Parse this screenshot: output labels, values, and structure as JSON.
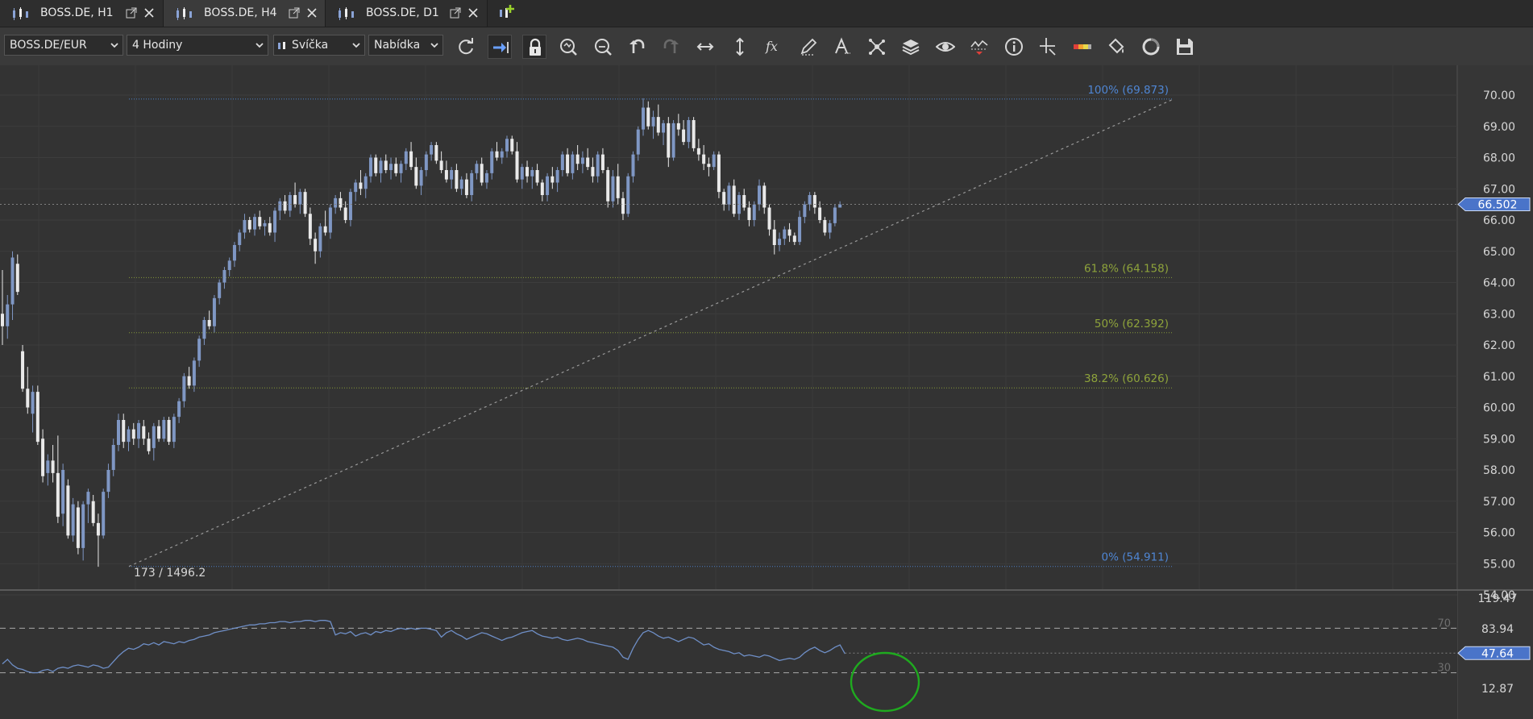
{
  "tabs": [
    {
      "label": "BOSS.DE, H1",
      "active": false
    },
    {
      "label": "BOSS.DE, H4",
      "active": true
    },
    {
      "label": "BOSS.DE, D1",
      "active": false
    }
  ],
  "toolbar": {
    "instrument": "BOSS.DE/EUR",
    "period": "4 Hodiny",
    "chart_type": "Svíčka",
    "offer_side": "Nabídka",
    "tools": [
      "refresh-icon",
      "shift-chart-icon",
      "lock-icon",
      "zoom-in-icon",
      "zoom-out-icon",
      "undo-icon",
      "redo-icon",
      "horizontal-scale-icon",
      "vertical-scale-icon",
      "indicators-fx-icon",
      "draw-pencil-icon",
      "text-tool-icon",
      "patterns-icon",
      "layers-icon",
      "eye-icon",
      "alerts-chart-icon",
      "info-icon",
      "crosshair-icon",
      "theme-color-icon",
      "paint-bucket-icon",
      "template-icon",
      "save-icon"
    ]
  },
  "colors": {
    "background": "#343434",
    "bull_candle": "#7f97c4",
    "bear_candle": "#e9e9e9",
    "fib_blue": "#4f86d4",
    "fib_green": "#8ea33b",
    "rsi_line": "#6f8fc7",
    "highlight_circle": "#1faa1f"
  },
  "chart_data": {
    "type": "candlestick",
    "symbol": "BOSS.DE/EUR",
    "period": "4 Hodiny",
    "price_axis_ticks": [
      "70.00",
      "69.00",
      "68.00",
      "67.00",
      "66.00",
      "65.00",
      "64.00",
      "63.00",
      "62.00",
      "61.00",
      "60.00",
      "59.00",
      "58.00",
      "57.00",
      "56.00",
      "55.00",
      "54.00"
    ],
    "current_price": "66.502",
    "ohlc": [
      [
        63.0,
        64.4,
        62.0,
        62.6
      ],
      [
        62.6,
        63.6,
        62.2,
        63.3
      ],
      [
        63.3,
        65.0,
        62.8,
        64.8
      ],
      [
        64.6,
        64.9,
        63.6,
        63.7
      ],
      [
        61.8,
        62.0,
        60.5,
        60.6
      ],
      [
        60.6,
        61.3,
        59.8,
        60.0
      ],
      [
        59.8,
        60.7,
        59.2,
        60.5
      ],
      [
        60.5,
        60.7,
        58.8,
        58.9
      ],
      [
        59.0,
        59.3,
        57.6,
        57.8
      ],
      [
        57.9,
        58.5,
        57.5,
        58.3
      ],
      [
        58.3,
        58.8,
        57.6,
        57.9
      ],
      [
        57.9,
        59.1,
        56.3,
        56.5
      ],
      [
        56.6,
        58.2,
        56.2,
        58.0
      ],
      [
        57.5,
        57.7,
        55.8,
        55.9
      ],
      [
        55.9,
        57.1,
        55.7,
        56.9
      ],
      [
        56.8,
        57.0,
        55.3,
        55.5
      ],
      [
        55.5,
        57.0,
        55.1,
        56.9
      ],
      [
        56.9,
        57.4,
        56.3,
        57.3
      ],
      [
        57.0,
        57.2,
        56.2,
        56.3
      ],
      [
        56.3,
        56.6,
        54.9,
        55.9
      ],
      [
        55.9,
        57.4,
        55.8,
        57.3
      ],
      [
        57.3,
        58.2,
        57.1,
        58.0
      ],
      [
        58.0,
        59.0,
        57.8,
        58.8
      ],
      [
        58.8,
        59.8,
        58.6,
        59.6
      ],
      [
        59.6,
        59.8,
        58.7,
        58.9
      ],
      [
        58.9,
        59.4,
        58.6,
        59.3
      ],
      [
        59.3,
        59.5,
        58.8,
        59.0
      ],
      [
        59.0,
        59.6,
        58.7,
        59.5
      ],
      [
        59.4,
        59.6,
        58.8,
        59.0
      ],
      [
        59.0,
        59.2,
        58.5,
        58.6
      ],
      [
        58.7,
        59.5,
        58.3,
        59.4
      ],
      [
        59.4,
        59.6,
        58.9,
        59.0
      ],
      [
        59.0,
        59.7,
        58.9,
        59.6
      ],
      [
        59.6,
        59.7,
        58.8,
        58.9
      ],
      [
        58.9,
        59.8,
        58.7,
        59.7
      ],
      [
        59.7,
        60.3,
        59.5,
        60.2
      ],
      [
        60.2,
        61.1,
        60.0,
        61.0
      ],
      [
        61.0,
        61.3,
        60.6,
        60.7
      ],
      [
        60.7,
        61.6,
        60.5,
        61.5
      ],
      [
        61.5,
        62.3,
        61.3,
        62.2
      ],
      [
        62.2,
        62.9,
        62.0,
        62.8
      ],
      [
        62.8,
        63.1,
        62.5,
        62.6
      ],
      [
        62.6,
        63.6,
        62.4,
        63.5
      ],
      [
        63.5,
        64.1,
        63.3,
        64.0
      ],
      [
        64.0,
        64.5,
        63.8,
        64.4
      ],
      [
        64.4,
        64.8,
        64.2,
        64.7
      ],
      [
        64.7,
        65.3,
        64.5,
        65.2
      ],
      [
        65.2,
        65.7,
        65.0,
        65.6
      ],
      [
        65.6,
        66.2,
        65.4,
        66.0
      ],
      [
        66.0,
        66.1,
        65.6,
        65.7
      ],
      [
        65.7,
        66.2,
        65.5,
        66.1
      ],
      [
        66.1,
        66.3,
        65.7,
        65.8
      ],
      [
        65.8,
        66.0,
        65.5,
        65.9
      ],
      [
        65.9,
        66.1,
        65.5,
        65.6
      ],
      [
        65.6,
        66.4,
        65.3,
        66.3
      ],
      [
        66.3,
        66.7,
        66.0,
        66.6
      ],
      [
        66.6,
        66.8,
        66.2,
        66.3
      ],
      [
        66.3,
        66.9,
        66.1,
        66.8
      ],
      [
        66.8,
        67.2,
        66.4,
        66.5
      ],
      [
        66.5,
        67.0,
        66.2,
        66.9
      ],
      [
        66.9,
        67.0,
        66.1,
        66.2
      ],
      [
        66.2,
        66.4,
        65.2,
        65.4
      ],
      [
        65.4,
        65.6,
        64.6,
        65.0
      ],
      [
        65.0,
        65.9,
        64.8,
        65.8
      ],
      [
        65.8,
        66.3,
        65.5,
        65.6
      ],
      [
        65.6,
        66.5,
        65.4,
        66.4
      ],
      [
        66.4,
        66.8,
        66.2,
        66.7
      ],
      [
        66.7,
        66.9,
        66.3,
        66.4
      ],
      [
        66.4,
        66.6,
        65.9,
        66.0
      ],
      [
        66.0,
        67.0,
        65.8,
        66.9
      ],
      [
        66.9,
        67.3,
        66.6,
        67.2
      ],
      [
        67.2,
        67.6,
        66.8,
        67.0
      ],
      [
        67.0,
        67.5,
        66.7,
        67.4
      ],
      [
        67.4,
        68.1,
        67.2,
        68.0
      ],
      [
        68.0,
        68.1,
        67.4,
        67.5
      ],
      [
        67.5,
        68.0,
        67.2,
        67.9
      ],
      [
        67.9,
        68.1,
        67.5,
        67.6
      ],
      [
        67.6,
        68.0,
        67.3,
        67.8
      ],
      [
        67.8,
        68.0,
        67.4,
        67.5
      ],
      [
        67.5,
        67.9,
        67.2,
        67.8
      ],
      [
        67.8,
        68.3,
        67.6,
        68.2
      ],
      [
        68.2,
        68.5,
        67.6,
        67.7
      ],
      [
        67.7,
        68.0,
        67.0,
        67.1
      ],
      [
        67.1,
        67.7,
        66.8,
        67.6
      ],
      [
        67.6,
        68.2,
        67.4,
        68.1
      ],
      [
        68.1,
        68.5,
        67.9,
        68.4
      ],
      [
        68.4,
        68.5,
        67.8,
        67.9
      ],
      [
        67.9,
        68.2,
        67.5,
        67.6
      ],
      [
        67.6,
        67.9,
        67.2,
        67.3
      ],
      [
        67.3,
        67.7,
        67.0,
        67.6
      ],
      [
        67.6,
        67.8,
        66.9,
        67.0
      ],
      [
        67.0,
        67.4,
        66.8,
        67.3
      ],
      [
        67.3,
        67.5,
        66.7,
        66.8
      ],
      [
        66.8,
        67.6,
        66.6,
        67.5
      ],
      [
        67.5,
        67.9,
        67.3,
        67.8
      ],
      [
        67.8,
        68.0,
        67.1,
        67.2
      ],
      [
        67.2,
        67.6,
        67.0,
        67.5
      ],
      [
        67.5,
        68.3,
        67.3,
        68.2
      ],
      [
        68.2,
        68.5,
        67.9,
        68.0
      ],
      [
        68.0,
        68.3,
        67.8,
        68.2
      ],
      [
        68.2,
        68.7,
        68.0,
        68.6
      ],
      [
        68.6,
        68.7,
        68.1,
        68.2
      ],
      [
        68.2,
        68.5,
        67.2,
        67.3
      ],
      [
        67.3,
        67.8,
        67.0,
        67.7
      ],
      [
        67.7,
        67.9,
        67.2,
        67.4
      ],
      [
        67.4,
        67.7,
        67.0,
        67.6
      ],
      [
        67.6,
        67.8,
        67.1,
        67.2
      ],
      [
        67.2,
        67.3,
        66.6,
        66.8
      ],
      [
        66.8,
        67.5,
        66.6,
        67.4
      ],
      [
        67.4,
        67.7,
        67.0,
        67.2
      ],
      [
        67.2,
        67.7,
        66.9,
        67.6
      ],
      [
        67.6,
        68.2,
        67.4,
        68.1
      ],
      [
        68.1,
        68.3,
        67.4,
        67.5
      ],
      [
        67.5,
        68.2,
        67.3,
        68.1
      ],
      [
        68.1,
        68.4,
        67.6,
        67.8
      ],
      [
        67.8,
        68.2,
        67.5,
        68.0
      ],
      [
        68.0,
        68.3,
        67.6,
        67.7
      ],
      [
        67.7,
        68.0,
        67.2,
        67.4
      ],
      [
        67.4,
        68.2,
        67.2,
        68.1
      ],
      [
        68.1,
        68.3,
        67.5,
        67.6
      ],
      [
        67.6,
        67.7,
        66.4,
        66.6
      ],
      [
        66.6,
        67.6,
        66.4,
        67.4
      ],
      [
        67.4,
        67.8,
        66.5,
        66.7
      ],
      [
        66.7,
        66.9,
        66.0,
        66.2
      ],
      [
        66.2,
        67.5,
        66.1,
        67.4
      ],
      [
        67.4,
        68.2,
        67.2,
        68.1
      ],
      [
        68.1,
        69.0,
        67.9,
        68.9
      ],
      [
        68.9,
        69.9,
        68.7,
        69.6
      ],
      [
        69.6,
        69.8,
        68.9,
        69.0
      ],
      [
        69.0,
        69.5,
        68.6,
        69.3
      ],
      [
        69.3,
        69.7,
        68.7,
        68.8
      ],
      [
        68.8,
        69.2,
        68.4,
        69.1
      ],
      [
        69.1,
        69.3,
        67.7,
        68.0
      ],
      [
        68.0,
        69.2,
        67.9,
        69.1
      ],
      [
        69.1,
        69.4,
        68.7,
        68.9
      ],
      [
        68.9,
        69.2,
        68.4,
        68.5
      ],
      [
        68.5,
        69.3,
        68.3,
        69.2
      ],
      [
        69.2,
        69.3,
        68.2,
        68.3
      ],
      [
        68.3,
        68.6,
        67.9,
        68.1
      ],
      [
        68.1,
        68.4,
        67.6,
        67.8
      ],
      [
        67.8,
        68.0,
        67.4,
        67.7
      ],
      [
        67.7,
        68.2,
        67.6,
        68.1
      ],
      [
        68.1,
        68.2,
        66.7,
        66.9
      ],
      [
        66.9,
        67.0,
        66.3,
        66.5
      ],
      [
        66.5,
        67.2,
        66.3,
        67.1
      ],
      [
        67.1,
        67.3,
        66.1,
        66.2
      ],
      [
        66.2,
        66.9,
        66.0,
        66.8
      ],
      [
        66.8,
        67.0,
        66.3,
        66.4
      ],
      [
        66.4,
        66.6,
        65.8,
        66.0
      ],
      [
        66.0,
        66.6,
        65.8,
        66.5
      ],
      [
        66.5,
        67.3,
        66.3,
        67.1
      ],
      [
        67.1,
        67.2,
        66.2,
        66.4
      ],
      [
        66.4,
        66.5,
        65.5,
        65.7
      ],
      [
        65.7,
        66.0,
        64.9,
        65.2
      ],
      [
        65.2,
        65.6,
        65.0,
        65.4
      ],
      [
        65.4,
        65.8,
        65.2,
        65.7
      ],
      [
        65.7,
        65.9,
        65.3,
        65.5
      ],
      [
        65.5,
        65.6,
        65.2,
        65.3
      ],
      [
        65.3,
        66.3,
        65.2,
        66.1
      ],
      [
        66.1,
        66.6,
        65.9,
        66.5
      ],
      [
        66.5,
        66.9,
        66.3,
        66.8
      ],
      [
        66.8,
        66.9,
        66.2,
        66.4
      ],
      [
        66.4,
        66.6,
        65.9,
        66.0
      ],
      [
        66.0,
        66.1,
        65.5,
        65.6
      ],
      [
        65.6,
        66.0,
        65.4,
        65.9
      ],
      [
        65.9,
        66.5,
        65.8,
        66.4
      ],
      [
        66.4,
        66.6,
        66.4,
        66.5
      ]
    ],
    "fibonacci": [
      {
        "label": "100% (69.873)",
        "value": 69.873,
        "color": "#4f86d4"
      },
      {
        "label": "61.8% (64.158)",
        "value": 64.158,
        "color": "#8ea33b"
      },
      {
        "label": "50% (62.392)",
        "value": 62.392,
        "color": "#8ea33b"
      },
      {
        "label": "38.2% (60.626)",
        "value": 60.626,
        "color": "#8ea33b"
      },
      {
        "label": "0% (54.911)",
        "value": 54.911,
        "color": "#4f86d4"
      }
    ],
    "cursor_readout": "173 / 1496.2",
    "oscillator": {
      "axis_ticks": [
        "119.47",
        "83.94",
        "12.87"
      ],
      "levels": [
        {
          "label": "70",
          "value": 70
        },
        {
          "label": "30",
          "value": 30
        }
      ],
      "current": "47.64",
      "values": [
        38,
        42,
        37,
        34,
        33,
        31,
        30,
        30,
        32,
        33,
        31,
        34,
        35,
        34,
        36,
        37,
        36,
        35,
        37,
        36,
        34,
        35,
        40,
        45,
        49,
        52,
        51,
        53,
        56,
        55,
        57,
        55,
        58,
        57,
        56,
        58,
        57,
        59,
        60,
        62,
        63,
        64,
        66,
        67,
        68,
        69,
        70,
        71,
        72,
        73,
        73,
        74,
        74,
        75,
        75,
        76,
        76,
        75,
        76,
        76,
        77,
        77,
        76,
        77,
        77,
        76,
        64,
        66,
        65,
        67,
        63,
        65,
        66,
        64,
        67,
        66,
        68,
        67,
        69,
        70,
        69,
        70,
        69,
        70,
        70,
        69,
        68,
        62,
        66,
        68,
        65,
        63,
        60,
        62,
        64,
        66,
        65,
        63,
        61,
        59,
        61,
        62,
        64,
        66,
        67,
        68,
        65,
        63,
        62,
        61,
        62,
        60,
        59,
        60,
        61,
        60,
        58,
        57,
        56,
        55,
        54,
        53,
        50,
        44,
        42,
        52,
        60,
        66,
        68,
        66,
        63,
        61,
        62,
        60,
        58,
        60,
        62,
        61,
        58,
        55,
        56,
        53,
        51,
        50,
        49,
        47,
        48,
        45,
        46,
        45,
        44,
        46,
        45,
        43,
        41,
        42,
        43,
        42,
        44,
        48,
        51,
        53,
        50,
        48,
        50,
        53,
        55,
        47
      ]
    }
  }
}
